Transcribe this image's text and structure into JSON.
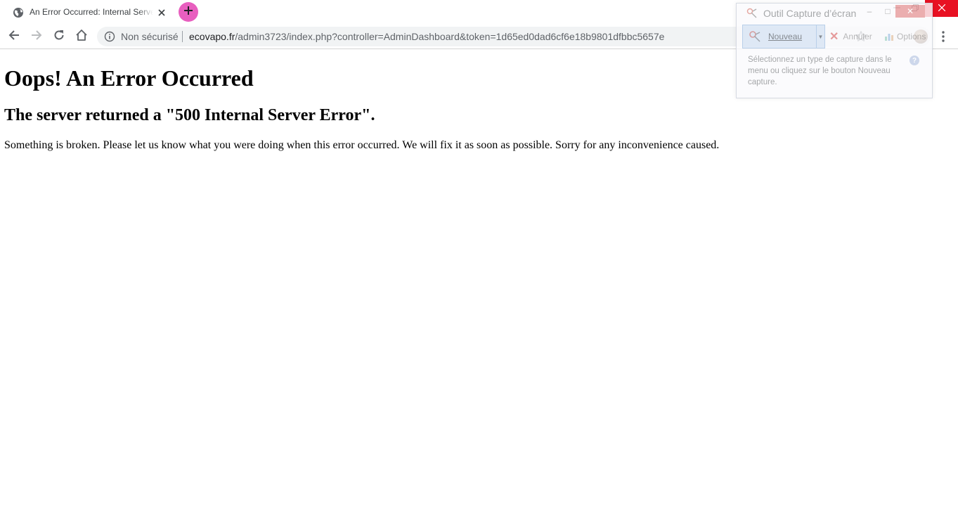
{
  "tab": {
    "title": "An Error Occurred: Internal Server Error",
    "favicon_icon": "globe-icon",
    "close_icon": "close-icon"
  },
  "new_tab": {
    "icon": "plus-icon",
    "color": "#e85fbf"
  },
  "window_controls": {
    "minimize_icon": "minimize-icon",
    "maximize_icon": "restore-icon",
    "close_icon": "close-icon",
    "close_color": "#e81123"
  },
  "toolbar": {
    "back_icon": "back-arrow-icon",
    "forward_icon": "forward-arrow-icon",
    "reload_icon": "reload-icon",
    "home_icon": "home-icon",
    "security_label": "Non sécurisé",
    "security_icon": "info-icon",
    "url_domain": "ecovapo.fr",
    "url_path": "/admin3723/index.php?controller=AdminDashboard&token=1d65ed0dad6cf6e18b9801dfbbc5657e",
    "bookmark_icon": "star-icon",
    "menu_icon": "more-vert-icon"
  },
  "page": {
    "heading": "Oops! An Error Occurred",
    "subheading": "The server returned a \"500 Internal Server Error\".",
    "message": "Something is broken. Please let us know what you were doing when this error occurred. We will fix it as soon as possible. Sorry for any inconvenience caused."
  },
  "snipping_tool": {
    "title": "Outil Capture d’écran",
    "new_label": "Nouveau",
    "cancel_label": "Annuler",
    "options_label": "Options",
    "help_text": "Sélectionnez un type de capture dans le menu ou cliquez sur le bouton Nouveau capture.",
    "help_icon": "?"
  }
}
